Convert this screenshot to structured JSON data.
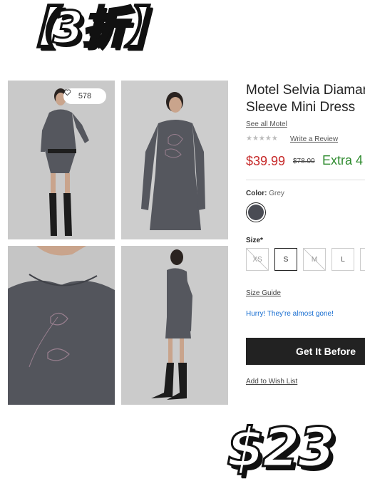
{
  "overlay": {
    "tag": "【3折】",
    "price": "$23"
  },
  "gallery": {
    "likes_count": "578",
    "images": [
      "photo-front-full",
      "photo-front-three-quarter",
      "photo-closeup-embroidery",
      "photo-side-full"
    ]
  },
  "product": {
    "title_line1": "Motel Selvia Diaman",
    "title_line2": "Sleeve Mini Dress",
    "brand_link": "See all Motel",
    "rating_stars": "★★★★★",
    "rating_value": 0,
    "review_link": "Write a Review",
    "price": "$39.99",
    "original_price": "$78.00",
    "promo": "Extra 4",
    "color_label": "Color:",
    "color_value": "Grey",
    "size_label": "Size*",
    "sizes": [
      {
        "label": "XS",
        "state": "out-of-stock"
      },
      {
        "label": "S",
        "state": "selected"
      },
      {
        "label": "M",
        "state": "out-of-stock"
      },
      {
        "label": "L",
        "state": "available"
      }
    ],
    "size_guide": "Size Guide",
    "stock_message": "Hurry! They're almost gone!",
    "cta_label": "Get It Before",
    "wishlist_link": "Add to Wish List"
  },
  "colors": {
    "price_red": "#c62828",
    "promo_green": "#2e8b2e",
    "stock_blue": "#1a6fd1",
    "cta_black": "#222222",
    "swatch_grey": "#4a4c54"
  }
}
